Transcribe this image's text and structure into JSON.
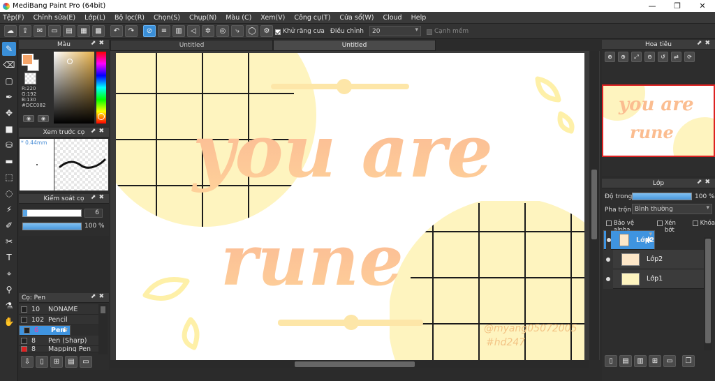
{
  "window": {
    "title": "MediBang Paint Pro (64bit)",
    "minimize": "—",
    "maximize": "❐",
    "close": "✕"
  },
  "menu": [
    "Tệp(F)",
    "Chỉnh sửa(E)",
    "Lớp(L)",
    "Bộ lọc(R)",
    "Chọn(S)",
    "Chụp(N)",
    "Màu (C)",
    "Xem(V)",
    "Công cụ(T)",
    "Cửa sổ(W)",
    "Cloud",
    "Help"
  ],
  "toolbar": {
    "antialias_label": "Khử răng cưa",
    "adjust_label": "Điều chỉnh",
    "adjust_value": "20",
    "edge_label": "Cạnh mềm"
  },
  "color_panel": {
    "title": "Màu",
    "r": "R:220",
    "g": "G:192",
    "b": "B:130",
    "hex": "#DCC082",
    "primary": "#DCC082"
  },
  "brush_preview": {
    "title": "Xem trước cọ",
    "size_label": "0.44mm"
  },
  "brush_control": {
    "title": "Kiểm soát cọ",
    "size_value": "6",
    "opacity_value": "100 %",
    "opacity_fraction": 1.0
  },
  "brushes": {
    "title": "Cọ: Pen",
    "items": [
      {
        "size": "10",
        "name": "NONAME",
        "color": "#222222"
      },
      {
        "size": "102",
        "name": "Pencil",
        "color": "#222222"
      },
      {
        "size": "6",
        "name": "Pen",
        "color": "#222222"
      },
      {
        "size": "8",
        "name": "Pen (Sharp)",
        "color": "#222222"
      },
      {
        "size": "8",
        "name": "Mapping Pen",
        "color": "#dd2222"
      }
    ],
    "selected_index": 2
  },
  "tabs": [
    "Untitled",
    "Untitled"
  ],
  "canvas": {
    "line1": "you are",
    "line2": "rune",
    "signature1": "@myang05072005",
    "signature2": "#hd247"
  },
  "navigator": {
    "title": "Hoa tiêu"
  },
  "layers": {
    "title": "Lớp",
    "opacity_label": "Độ trong",
    "opacity_value": "100 %",
    "opacity_fraction": 1.0,
    "blend_label": "Pha trộn",
    "blend_value": "Bình thường",
    "protect_alpha": "Bảo vệ alpha",
    "clipping": "Xén bớt",
    "lock": "Khóa",
    "items": [
      {
        "name": "Lớp2",
        "selected": true
      },
      {
        "name": "Lớp2",
        "selected": false
      },
      {
        "name": "Lớp1",
        "selected": false
      }
    ]
  },
  "colors": {
    "accent": "#3f94e0",
    "peach": "#f9b98c",
    "yellow": "#fef4bf",
    "grid": "#1b1b1b"
  }
}
